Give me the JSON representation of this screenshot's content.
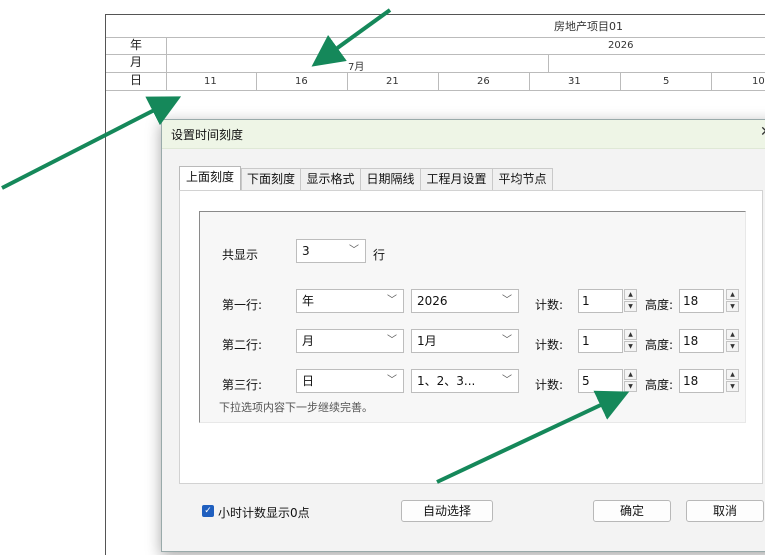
{
  "gantt": {
    "project_title": "房地产项目01",
    "row_labels": [
      "年",
      "月",
      "日"
    ],
    "year": "2026",
    "month": "7月",
    "days": [
      "11",
      "16",
      "21",
      "26",
      "31",
      "5",
      "10"
    ]
  },
  "dialog": {
    "title": "设置时间刻度",
    "close_icon": "close-icon",
    "tabs": [
      "上面刻度",
      "下面刻度",
      "显示格式",
      "日期隔线",
      "工程月设置",
      "平均节点"
    ],
    "active_tab": 0,
    "total_rows_label": "共显示",
    "total_rows_value": "3",
    "total_rows_unit": "行",
    "rows": [
      {
        "label": "第一行:",
        "unit": "年",
        "start": "2026",
        "count_label": "计数:",
        "count": "1",
        "height_label": "高度:",
        "height": "18"
      },
      {
        "label": "第二行:",
        "unit": "月",
        "start": "1月",
        "count_label": "计数:",
        "count": "1",
        "height_label": "高度:",
        "height": "18"
      },
      {
        "label": "第三行:",
        "unit": "日",
        "start": "1、2、3...",
        "count_label": "计数:",
        "count": "5",
        "height_label": "高度:",
        "height": "18"
      }
    ],
    "hint": "下拉选项内容下一步继续完善。",
    "hour_checkbox_label": "小时计数显示0点",
    "hour_checkbox_checked": true,
    "auto_select_button": "自动选择",
    "ok_button": "确定",
    "cancel_button": "取消"
  },
  "colors": {
    "arrow": "#15885a",
    "titlebar": "#eef5e6",
    "checkbox": "#1f5fbf"
  }
}
